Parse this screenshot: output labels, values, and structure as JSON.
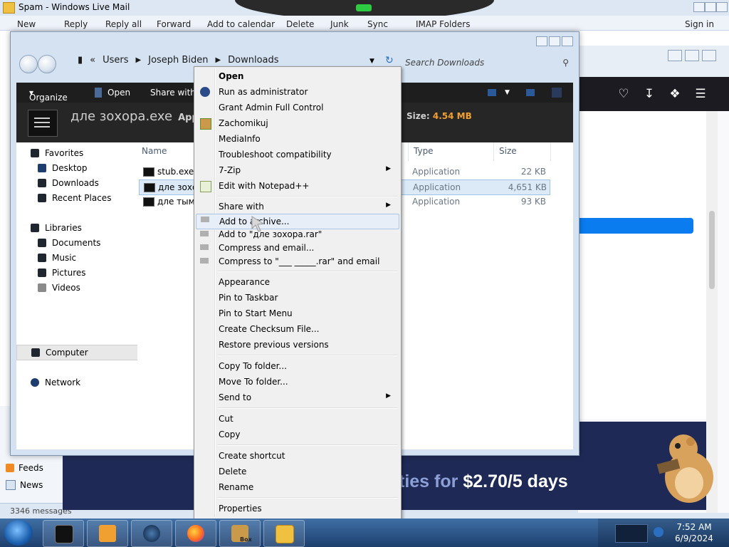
{
  "mail": {
    "window_title": "Spam - Windows Live Mail",
    "toolbar": [
      "New",
      "Reply",
      "Reply all",
      "Forward",
      "Add to calendar",
      "Delete",
      "Junk",
      "Sync",
      "IMAP Folders"
    ],
    "sign_in": "Sign in",
    "folders": [
      "Feeds",
      "News"
    ],
    "status": "3346 messages"
  },
  "explorer": {
    "breadcrumb": [
      "Users",
      "Joseph Biden",
      "Downloads"
    ],
    "search_placeholder": "Search Downloads",
    "commands": [
      "Organize",
      "Open",
      "Share with"
    ],
    "details": {
      "filename": "дле зохора.exe",
      "type_label": "Application",
      "size_label": "Size:",
      "size_value": "4.54 MB"
    },
    "nav": {
      "favorites": "Favorites",
      "favorites_items": [
        "Desktop",
        "Downloads",
        "Recent Places"
      ],
      "libraries": "Libraries",
      "libraries_items": [
        "Documents",
        "Music",
        "Pictures",
        "Videos"
      ],
      "computer": "Computer",
      "network": "Network"
    },
    "columns": [
      "Name",
      "Type",
      "Size"
    ],
    "files": [
      {
        "name": "stub.exe",
        "type": "Application",
        "size": "22 KB"
      },
      {
        "name": "дле зохора.exe",
        "type": "Application",
        "size": "4,651 KB"
      },
      {
        "name": "дле тымаж.exe",
        "type": "Application",
        "size": "93 KB"
      }
    ]
  },
  "context_menu": {
    "items": [
      {
        "label": "Open",
        "bold": true
      },
      {
        "label": "Run as administrator",
        "icon": "shield-icon"
      },
      {
        "label": "Grant Admin Full Control"
      },
      {
        "label": "Zachomikuj",
        "icon": "hamster-icon"
      },
      {
        "label": "MediaInfo"
      },
      {
        "label": "Troubleshoot compatibility"
      },
      {
        "label": "7-Zip",
        "submenu": true
      },
      {
        "label": "Edit with Notepad++",
        "icon": "notepad-icon"
      },
      {
        "label": "Share with",
        "submenu": true
      },
      {
        "label": "Add to archive...",
        "icon": "winrar-icon",
        "highlighted": true
      },
      {
        "label": "Add to \"дле зохора.rar\"",
        "icon": "winrar-icon"
      },
      {
        "label": "Compress and email...",
        "icon": "winrar-icon"
      },
      {
        "label": "Compress to \"___ _____.rar\" and email",
        "icon": "winrar-icon"
      },
      {
        "label": "Appearance"
      },
      {
        "label": "Pin to Taskbar"
      },
      {
        "label": "Pin to Start Menu"
      },
      {
        "label": "Create Checksum File..."
      },
      {
        "label": "Restore previous versions"
      },
      {
        "label": "Copy To folder..."
      },
      {
        "label": "Move To folder..."
      },
      {
        "label": "Send to",
        "submenu": true
      },
      {
        "label": "Cut"
      },
      {
        "label": "Copy"
      },
      {
        "label": "Create shortcut"
      },
      {
        "label": "Delete"
      },
      {
        "label": "Rename"
      },
      {
        "label": "Properties"
      }
    ]
  },
  "browser": {
    "banner_faded": "ties for",
    "banner_price": "$2.70/5 days"
  },
  "taskbar": {
    "time": "7:52 AM",
    "date": "6/9/2024",
    "button_label": "Box"
  },
  "colors": {
    "accent": "#0a7cf0",
    "size_highlight": "#f0a030",
    "menu_highlight": "#e7eef7"
  }
}
